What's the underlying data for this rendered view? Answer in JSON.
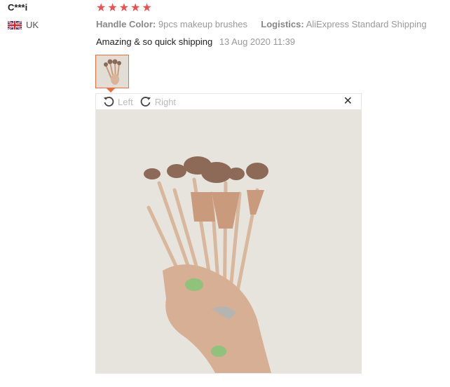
{
  "reviewer": {
    "name": "C***i",
    "country": "UK"
  },
  "rating": {
    "stars": 5,
    "max": 5
  },
  "meta": {
    "handle_label": "Handle Color:",
    "handle_value": "9pcs makeup brushes",
    "logistics_label": "Logistics:",
    "logistics_value": "AliExpress Standard Shipping"
  },
  "review": {
    "text": "Amazing & so quick shipping",
    "date": "13 Aug 2020 11:39"
  },
  "viewer": {
    "left_label": "Left",
    "right_label": "Right",
    "close_glyph": "✕"
  },
  "icons": {
    "flag": "uk-flag-icon",
    "star": "star-icon",
    "rotate_left": "rotate-left-icon",
    "rotate_right": "rotate-right-icon",
    "close": "close-icon"
  },
  "colors": {
    "star": "#f44c4c",
    "accent": "#f26b3a",
    "photo_bg": "#e7e4de"
  }
}
